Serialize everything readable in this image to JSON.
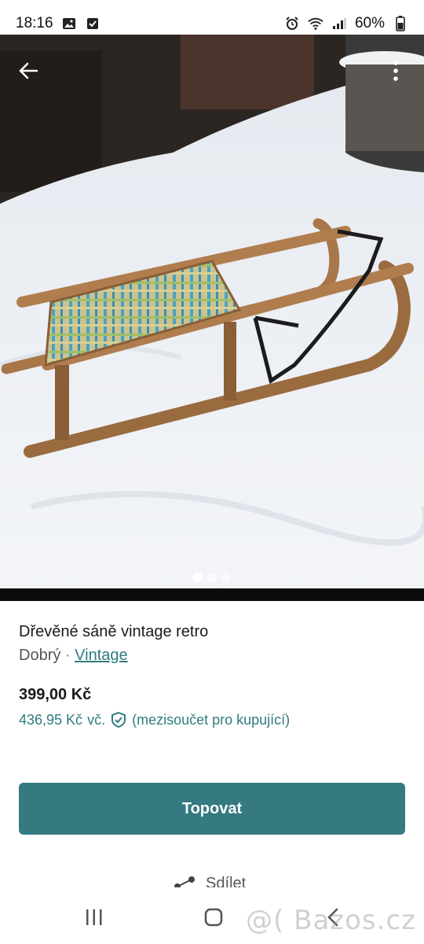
{
  "status": {
    "time": "18:16",
    "battery": "60%"
  },
  "gallery": {
    "image_count": 3,
    "active_index": 0
  },
  "listing": {
    "title": "Dřevěné sáně vintage retro",
    "condition": "Dobrý",
    "separator": "·",
    "brand": "Vintage",
    "price": "399,00 Kč",
    "price_incl": "436,95 Kč",
    "price_incl_suffix": "vč.",
    "price_incl_note": "(mezisoučet pro kupující)"
  },
  "actions": {
    "primary_label": "Topovat",
    "share_label": "Sdílet"
  },
  "watermark": "@( Bazos.cz",
  "colors": {
    "accent": "#357a80",
    "link": "#2f7c80"
  },
  "icons": [
    "back-arrow-icon",
    "more-vertical-icon",
    "shield-check-icon",
    "share-icon",
    "recent-apps-icon",
    "home-icon",
    "nav-back-icon"
  ]
}
